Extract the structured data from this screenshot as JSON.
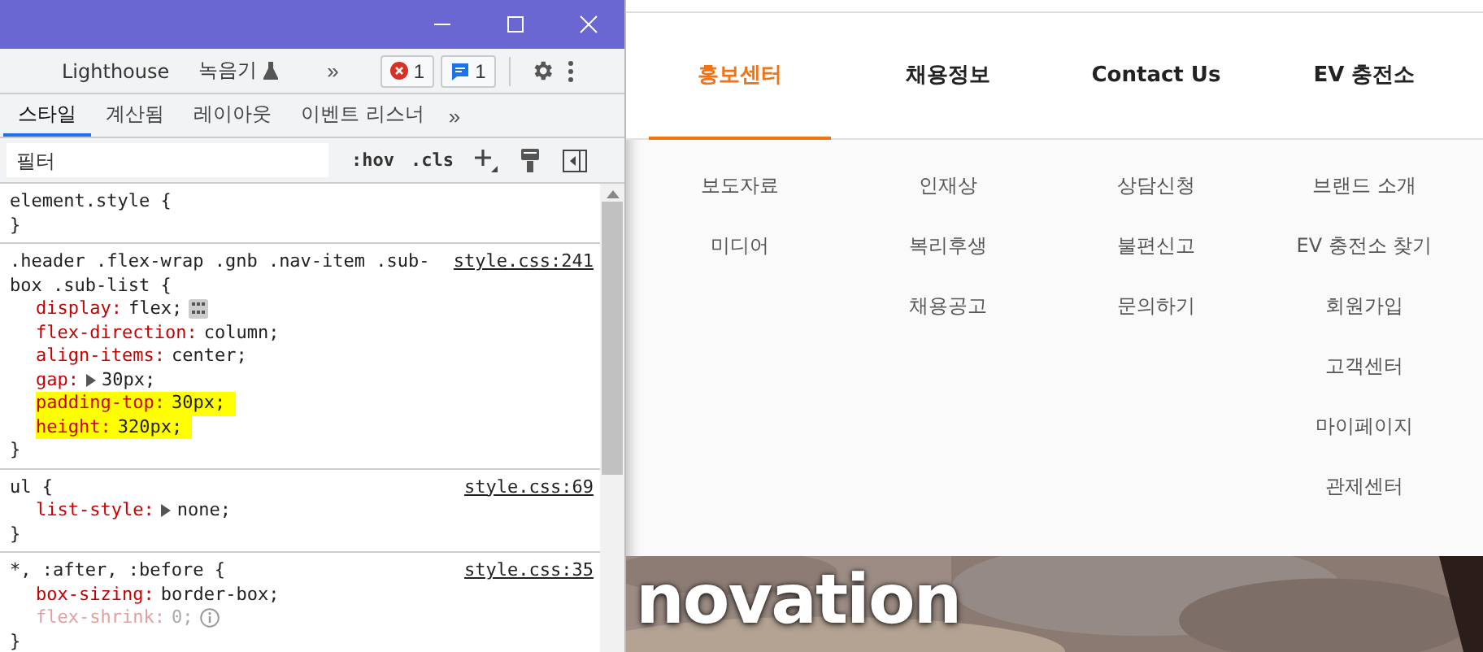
{
  "devtools": {
    "tabs": [
      {
        "label": "Lighthouse",
        "kind": "plain"
      },
      {
        "label": "녹음기",
        "kind": "experimental"
      }
    ],
    "tabs_more": "»",
    "errors": "1",
    "messages": "1",
    "panel_tabs": [
      {
        "label": "스타일",
        "selected": true
      },
      {
        "label": "계산됨",
        "selected": false
      },
      {
        "label": "레이아웃",
        "selected": false
      },
      {
        "label": "이벤트 리스너",
        "selected": false
      }
    ],
    "panel_more": "»",
    "filter": {
      "placeholder": "필터"
    },
    "toggles": [
      ":hov",
      ".cls"
    ],
    "rules": [
      {
        "selector": "element.style {"
      },
      {
        "selector": ".header .flex-wrap .gnb .nav-item .sub-box .sub-list {",
        "source": "style.css:241",
        "declarations": [
          {
            "property": "display:",
            "value": "flex;",
            "kind": "flex",
            "highlighted": false,
            "inactive": false
          },
          {
            "property": "flex-direction:",
            "value": "column;",
            "kind": "plain",
            "highlighted": false,
            "inactive": false
          },
          {
            "property": "align-items:",
            "value": "center;",
            "kind": "plain",
            "highlighted": false,
            "inactive": false
          },
          {
            "property": "gap:",
            "value": "30px;",
            "kind": "expand",
            "highlighted": false,
            "inactive": false
          },
          {
            "property": "padding-top:",
            "value": "30px;",
            "kind": "plain",
            "highlighted": true,
            "inactive": false
          },
          {
            "property": "height:",
            "value": "320px;",
            "kind": "plain",
            "highlighted": true,
            "inactive": false
          }
        ]
      },
      {
        "selector": "ul {",
        "source": "style.css:69",
        "declarations": [
          {
            "property": "list-style:",
            "value": "none;",
            "kind": "expand",
            "highlighted": false,
            "inactive": false
          }
        ]
      },
      {
        "selector": "*, :after, :before {",
        "source": "style.css:35",
        "declarations": [
          {
            "property": "box-sizing:",
            "value": "border-box;",
            "kind": "plain",
            "highlighted": false,
            "inactive": false
          },
          {
            "property": "flex-shrink:",
            "value": "0;",
            "kind": "info",
            "highlighted": false,
            "inactive": true
          }
        ]
      }
    ],
    "closing": "}"
  },
  "site": {
    "nav": [
      {
        "label": "홍보센터",
        "selected": true,
        "items": [
          "보도자료",
          "미디어"
        ]
      },
      {
        "label": "채용정보",
        "selected": false,
        "items": [
          "인재상",
          "복리후생",
          "채용공고"
        ]
      },
      {
        "label": "Contact Us",
        "selected": false,
        "items": [
          "상담신청",
          "불편신고",
          "문의하기"
        ]
      },
      {
        "label": "EV 충전소",
        "selected": false,
        "items": [
          "브랜드 소개",
          "EV 충전소 찾기",
          "회원가입",
          "고객센터",
          "마이페이지",
          "관제센터"
        ]
      }
    ],
    "hero_text": "novation"
  }
}
